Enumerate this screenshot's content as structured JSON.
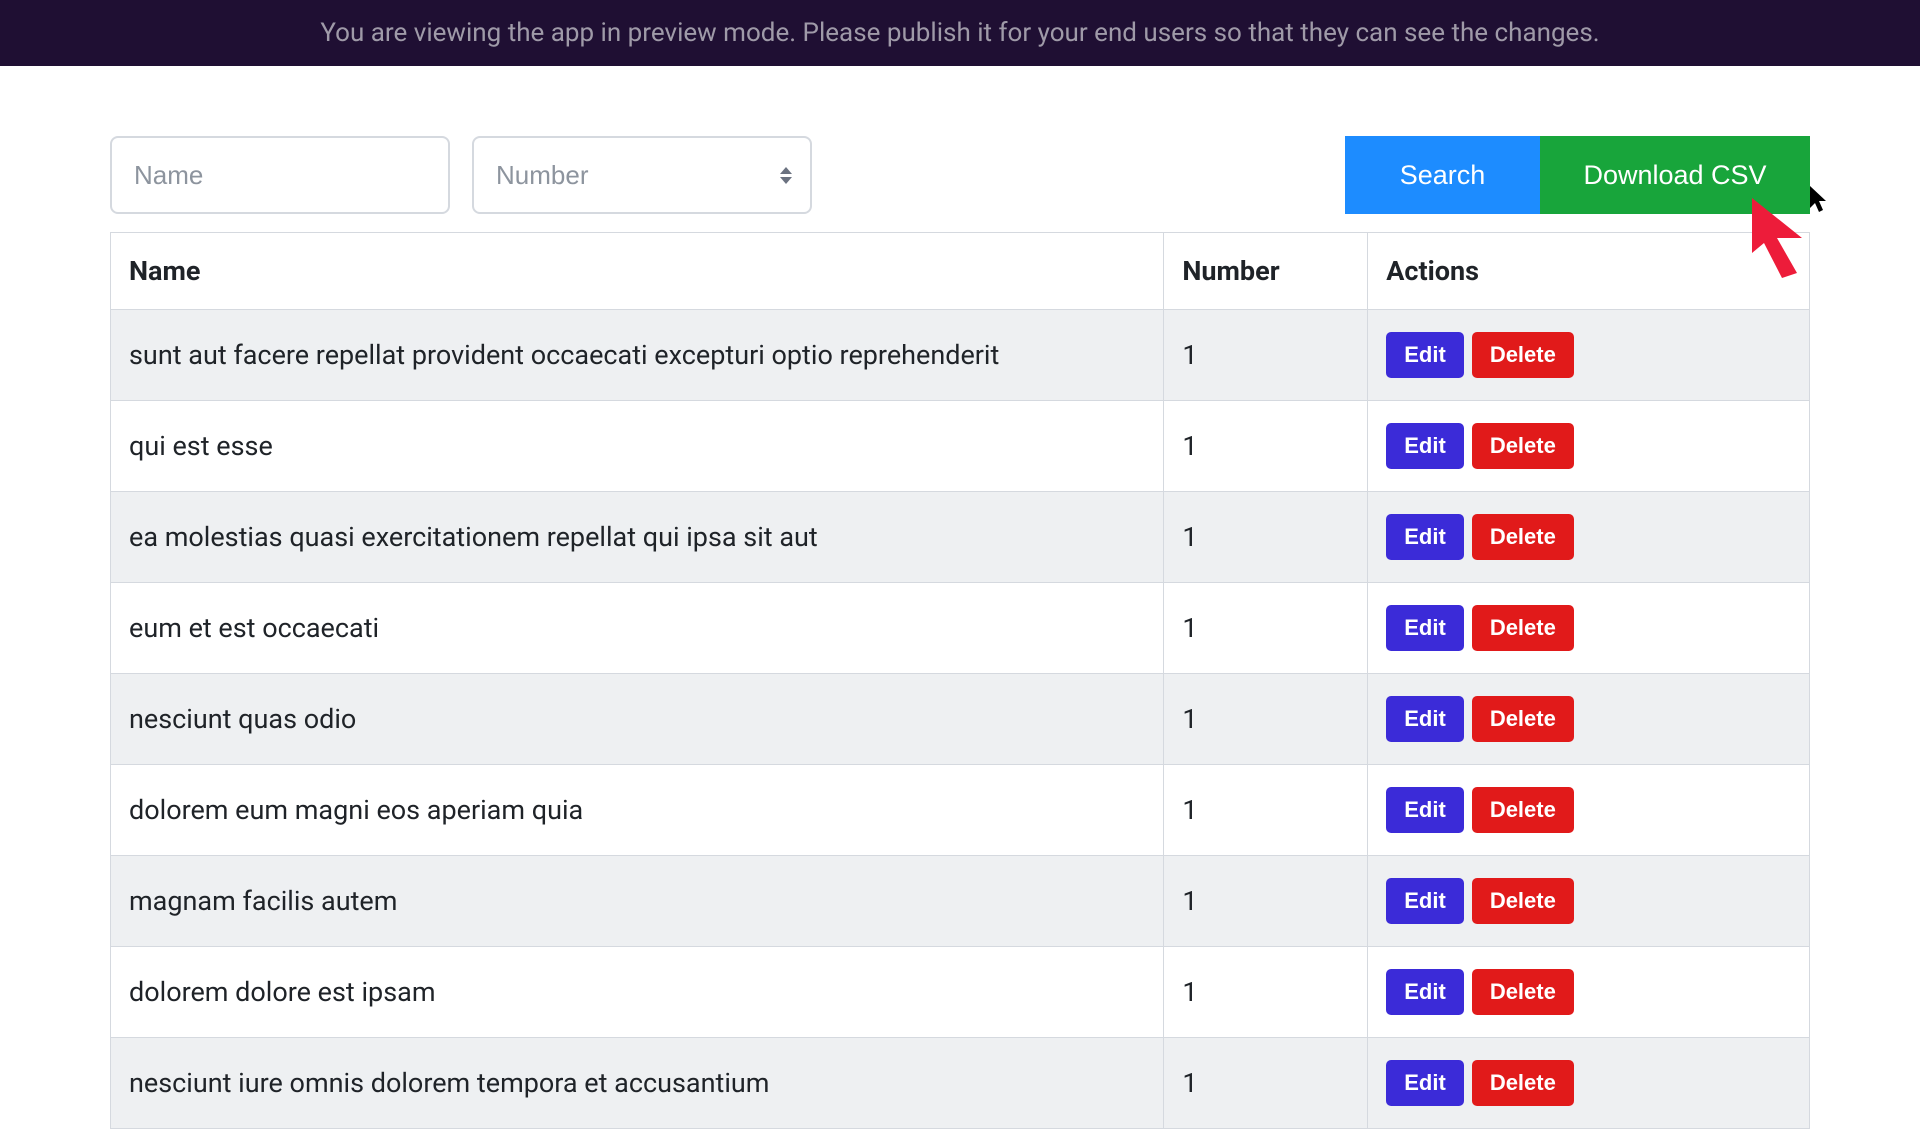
{
  "banner": {
    "text": "You are viewing the app in preview mode. Please publish it for your end users so that they can see the changes."
  },
  "filters": {
    "name_placeholder": "Name",
    "number_placeholder": "Number"
  },
  "buttons": {
    "search": "Search",
    "download_csv": "Download CSV",
    "edit": "Edit",
    "delete": "Delete"
  },
  "table": {
    "headers": {
      "name": "Name",
      "number": "Number",
      "actions": "Actions"
    },
    "rows": [
      {
        "name": "sunt aut facere repellat provident occaecati excepturi optio reprehenderit",
        "number": "1"
      },
      {
        "name": "qui est esse",
        "number": "1"
      },
      {
        "name": "ea molestias quasi exercitationem repellat qui ipsa sit aut",
        "number": "1"
      },
      {
        "name": "eum et est occaecati",
        "number": "1"
      },
      {
        "name": "nesciunt quas odio",
        "number": "1"
      },
      {
        "name": "dolorem eum magni eos aperiam quia",
        "number": "1"
      },
      {
        "name": "magnam facilis autem",
        "number": "1"
      },
      {
        "name": "dolorem dolore est ipsam",
        "number": "1"
      },
      {
        "name": "nesciunt iure omnis dolorem tempora et accusantium",
        "number": "1"
      }
    ]
  },
  "colors": {
    "banner_bg": "#1f0f33",
    "search_bg": "#1d8cff",
    "download_bg": "#18a53b",
    "edit_bg": "#3b2bd8",
    "delete_bg": "#e11a1a"
  }
}
